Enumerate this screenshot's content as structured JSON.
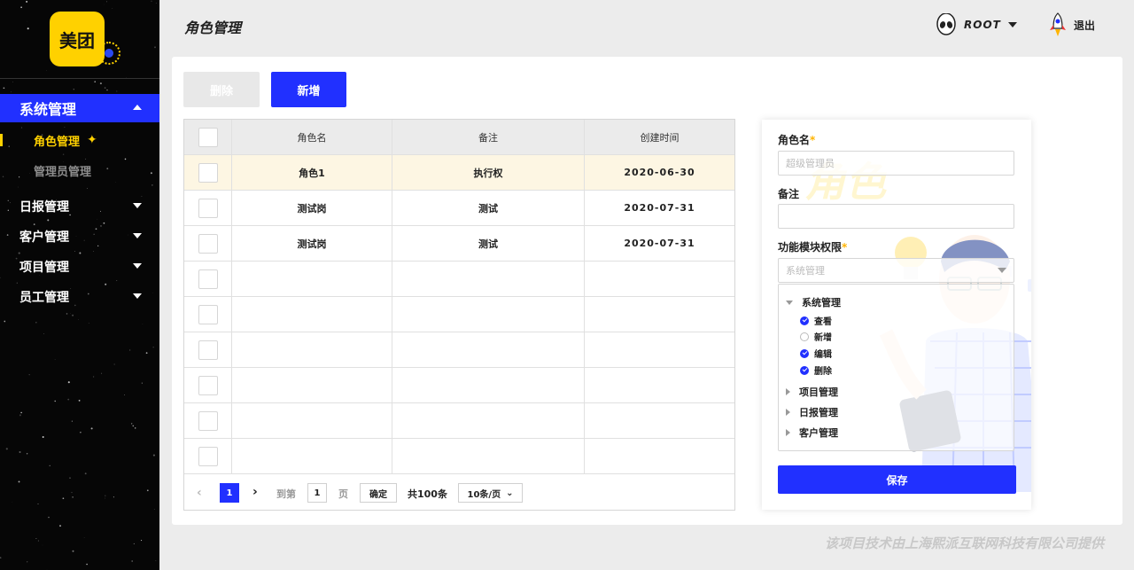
{
  "sidebar": {
    "logo_text": "美团",
    "groups": [
      {
        "label": "系统管理",
        "expanded": true
      },
      {
        "label": "日报管理"
      },
      {
        "label": "客户管理"
      },
      {
        "label": "项目管理"
      },
      {
        "label": "员工管理"
      }
    ],
    "items": [
      {
        "label": "角色管理",
        "current": true
      },
      {
        "label": "管理员管理"
      }
    ]
  },
  "header": {
    "title": "角色管理",
    "user_name": "ROOT",
    "logout_label": "退出"
  },
  "toolbar": {
    "delete_label": "删除",
    "add_label": "新增"
  },
  "table": {
    "columns": [
      "角色名",
      "备注",
      "创建时间"
    ],
    "rows": [
      {
        "name": "角色1",
        "note": "执行权",
        "created": "2020-06-30"
      },
      {
        "name": "测试岗",
        "note": "测试",
        "created": "2020-07-31"
      },
      {
        "name": "测试岗",
        "note": "测试",
        "created": "2020-07-31"
      },
      {
        "name": "",
        "note": "",
        "created": ""
      },
      {
        "name": "",
        "note": "",
        "created": ""
      },
      {
        "name": "",
        "note": "",
        "created": ""
      },
      {
        "name": "",
        "note": "",
        "created": ""
      },
      {
        "name": "",
        "note": "",
        "created": ""
      },
      {
        "name": "",
        "note": "",
        "created": ""
      }
    ]
  },
  "pagination": {
    "current": "1",
    "goto_label": "到第",
    "goto_value": "1",
    "page_label": "页",
    "confirm_label": "确定",
    "total_label": "共100条",
    "page_size": "10条/页"
  },
  "form": {
    "decor_text": "角色",
    "name_label": "角色名",
    "name_placeholder": "超级管理员",
    "note_label": "备注",
    "note_value": "",
    "perm_label": "功能模块权限",
    "perm_select": "系统管理",
    "tree": {
      "root_expanded": "系统管理",
      "leaves": [
        {
          "label": "查看",
          "checked": true
        },
        {
          "label": "新增",
          "checked": false
        },
        {
          "label": "编辑",
          "checked": true
        },
        {
          "label": "删除",
          "checked": true
        }
      ],
      "collapsed": [
        "项目管理",
        "日报管理",
        "客户管理"
      ]
    },
    "save_label": "保存"
  },
  "footer": "该项目技术由上海熙派互联网科技有限公司提供",
  "colors": {
    "accent": "#2130ff",
    "brand_yellow": "#ffd100",
    "sidebar_bg": "#060606",
    "highlight_row": "#fdf6e3"
  }
}
